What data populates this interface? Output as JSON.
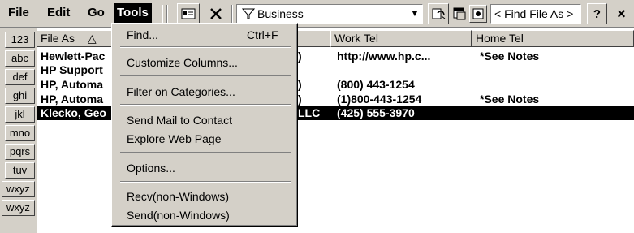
{
  "menubar": {
    "file": "File",
    "edit": "Edit",
    "go": "Go",
    "tools": "Tools"
  },
  "toolbar": {
    "category_filter": "Business",
    "find_placeholder": "< Find File As >",
    "help_label": "?",
    "close_label": "×"
  },
  "letters": [
    "123",
    "abc",
    "def",
    "ghi",
    "jkl",
    "mno",
    "pqrs",
    "tuv",
    "wxyz",
    "wxyz"
  ],
  "columns": {
    "file_as": "File As",
    "sort_indicator": "△",
    "work_tel": "Work Tel",
    "home_tel": "Home Tel"
  },
  "rows": [
    {
      "file_as": "Hewlett-Pac",
      "company_tail": ")",
      "work_tel": "http://www.hp.c...",
      "home_tel": "*See Notes"
    },
    {
      "file_as": "HP Support",
      "company_tail": "",
      "work_tel": "",
      "home_tel": ""
    },
    {
      "file_as": "HP, Automa",
      "company_tail": ")",
      "work_tel": "(800) 443-1254",
      "home_tel": ""
    },
    {
      "file_as": "HP, Automa",
      "company_tail": ")",
      "work_tel": "(1)800-443-1254",
      "home_tel": "*See Notes"
    },
    {
      "file_as": "Klecko, Geo",
      "company_tail": "LLC",
      "work_tel": "(425) 555-3970",
      "home_tel": ""
    }
  ],
  "selected_row_index": 4,
  "tools_menu": {
    "find": {
      "label": "Find...",
      "shortcut": "Ctrl+F"
    },
    "customize_columns": "Customize Columns...",
    "filter_on_categories": "Filter on Categories...",
    "send_mail": "Send Mail to Contact",
    "explore_web": "Explore Web Page",
    "options": "Options...",
    "recv": "Recv(non-Windows)",
    "send": "Send(non-Windows)"
  }
}
